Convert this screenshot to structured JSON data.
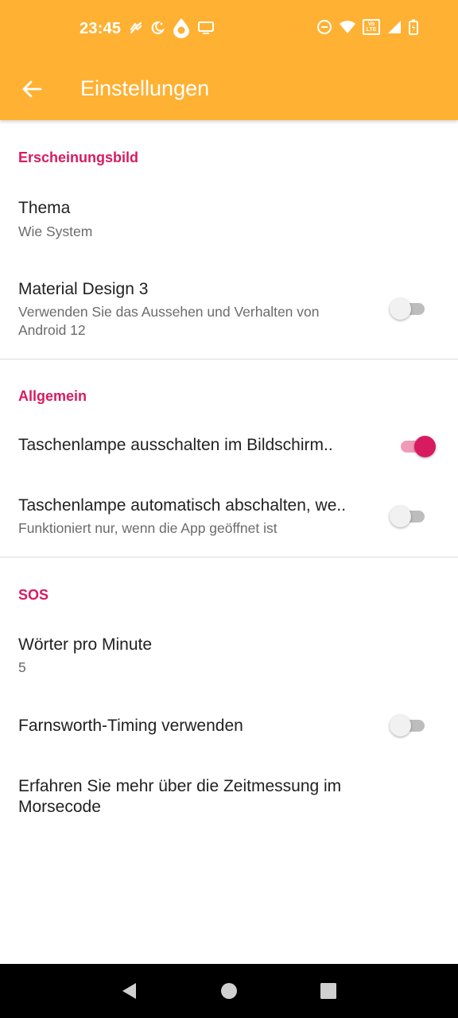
{
  "status_bar": {
    "time": "23:45",
    "left_icons": [
      "sync-icon",
      "night-mode-icon",
      "drop-icon",
      "cast-icon"
    ],
    "right_icons": [
      "dnd-icon",
      "wifi-icon",
      "volte-icon",
      "signal-icon",
      "battery-icon"
    ],
    "volte_label": "Vo LTE"
  },
  "app_bar": {
    "title": "Einstellungen",
    "color": "#ffb133"
  },
  "accent_color": "#d81b60",
  "sections": [
    {
      "header": "Erscheinungsbild",
      "items": [
        {
          "title": "Thema",
          "subtitle": "Wie System"
        },
        {
          "title": "Material Design 3",
          "subtitle": "Verwenden Sie das Aussehen und Verhalten von Android 12",
          "switch_on": false
        }
      ]
    },
    {
      "header": "Allgemein",
      "items": [
        {
          "title": "Taschenlampe ausschalten im Bildschirm..",
          "switch_on": true
        },
        {
          "title": "Taschenlampe automatisch abschalten, we..",
          "subtitle": "Funktioniert nur, wenn die App geöffnet ist",
          "switch_on": false
        }
      ]
    },
    {
      "header": "SOS",
      "items": [
        {
          "title": "Wörter pro Minute",
          "subtitle": "5"
        },
        {
          "title": "Farnsworth-Timing verwenden",
          "switch_on": false
        },
        {
          "title_line1": "Erfahren Sie mehr über die Zeitmessung im",
          "title_line2": "Morsecode"
        }
      ]
    }
  ]
}
